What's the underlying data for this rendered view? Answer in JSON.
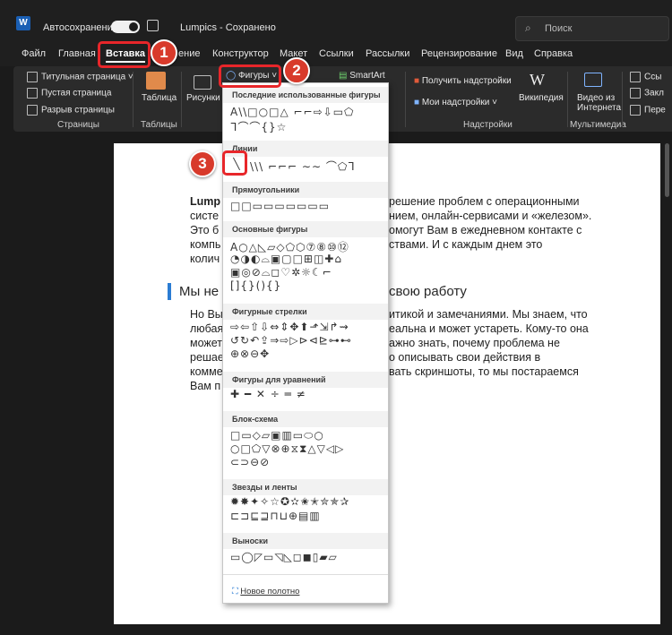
{
  "titlebar": {
    "app_icon": "W",
    "autosave_label": "Автосохранение",
    "doc_title": "Lumpics",
    "saved_status": "Сохранено",
    "search_placeholder": "Поиск"
  },
  "menu": {
    "tabs": [
      "Файл",
      "Главная",
      "Вставка",
      "ение",
      "Конструктор",
      "Макет",
      "Ссылки",
      "Рассылки",
      "Рецензирование",
      "Вид",
      "Справка"
    ],
    "active": "Вставка"
  },
  "ribbon": {
    "title_page": "Титульная страница",
    "blank_page": "Пустая страница",
    "page_break": "Разрыв страницы",
    "group_pages": "Страницы",
    "table": "Таблица",
    "group_tables": "Таблицы",
    "pictures": "Рисунки",
    "shapes": "Фигуры",
    "smartart": "SmartArt",
    "get_addins": "Получить надстройки",
    "my_addins": "Мои надстройки",
    "wikipedia": "Википедия",
    "group_addins": "Надстройки",
    "online_video_1": "Видео из",
    "online_video_2": "Интернета",
    "group_media": "Мультимедиа",
    "cut1": "Ссы",
    "cut2": "Закл",
    "cut3": "Пере"
  },
  "document": {
    "p1_line1_bold": "Lump",
    "p1_line1_rest": "решение проблем с операционными",
    "p1_line2_left": "систе",
    "p1_line2_right": "нием, онлайн-сервисами и «железом».",
    "p1_line3_left": "Это б",
    "p1_line3_right": "омогут Вам в ежедневном контакте с",
    "p1_line4_left": "компь",
    "p1_line4_right": "ствами. И с каждым днем это",
    "p1_line5_left": "колич",
    "heading_left": "Мы не",
    "heading_right": "свою работу",
    "p2_line1_left": "Но Вы",
    "p2_line1_right": "итикой и замечаниями. Мы знаем, что",
    "p2_line2_left": "любая",
    "p2_line2_right": "еальна и может устареть. Кому-то она",
    "p2_line3_left": "может",
    "p2_line3_right": "ажно знать, почему проблема не",
    "p2_line4_left": "решае",
    "p2_line4_right": "о описывать свои действия в",
    "p2_line5_left": "комме",
    "p2_line5_right": "вать скриншоты, то мы постараемся",
    "p2_line6_left": "Вам п"
  },
  "dropdown": {
    "recent": "Последние использованные фигуры",
    "lines": "Линии",
    "rectangles": "Прямоугольники",
    "basic": "Основные фигуры",
    "arrows": "Фигурные стрелки",
    "equations": "Фигуры для уравнений",
    "flowchart": "Блок-схема",
    "stars": "Звезды и ленты",
    "callouts": "Выноски",
    "new_canvas": "Новое полотно"
  },
  "shape_rows": {
    "recent1": "A\\\\□○□△ ⌐⌐⇨⇩▭⬠",
    "recent2": "ᒣ⌒⌒{}☆",
    "lines1": "\\\\\\ ⌐⌐⌐ ∼∼ ⌒⬠ᒣ",
    "rect1": "□□▭▭▭▭▭▭▭",
    "basic1": "A○△◺▱◇⬠⬡⑦⑧⑩⑫",
    "basic2": "◔◑◐⌓▣▢□⊞◫✚⌂",
    "basic3": "▣◎⊘⌓◻♡✲☼☾⌐",
    "basic4": "[]{}(){}",
    "arrows1": "⇨⇦⇧⇩⇔⇕✥⬆⬏⇲↱⇝",
    "arrows2": "↺↻↶⇪⇒⇨▷⊳⊲⊵⊶⊷",
    "arrows3": "⊕⊗⊖✥",
    "eq1": "✚ ━ ✕ ÷ ═ ≠",
    "flow1": "□▭◇▱▣▥▭⬭○",
    "flow2": "○□⬠▽⊗⊕⧖⧗△▽◁▷",
    "flow3": "⊂⊃⊖⊘",
    "stars1": "✹✸✦✧☆✪✫✬✭✮✯✰",
    "stars2": "⊏⊐⊑⊒⊓⊔⊕▤▥",
    "callouts1": "▭◯◸▭◹◺◻◼▯▰▱"
  },
  "callouts": [
    "1",
    "2",
    "3"
  ]
}
